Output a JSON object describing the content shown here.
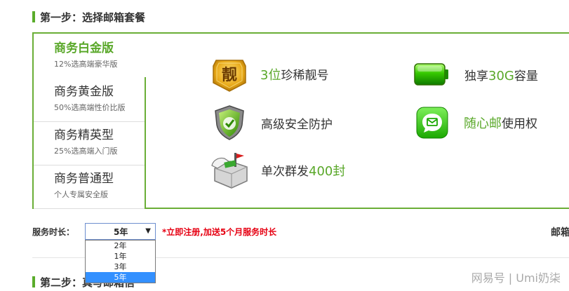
{
  "step1": {
    "title": "第一步：选择邮箱套餐"
  },
  "step2": {
    "title": "第二步：真写邮箱信"
  },
  "packages": [
    {
      "name": "商务白金版",
      "desc": "12%选高端豪华版",
      "active": true
    },
    {
      "name": "商务黄金版",
      "desc": "50%选高端性价比版",
      "active": false
    },
    {
      "name": "商务精英型",
      "desc": "25%选高端入门版",
      "active": false
    },
    {
      "name": "商务普通型",
      "desc": "个人专属安全版",
      "active": false
    }
  ],
  "features": {
    "numbers": {
      "highlight": "3位",
      "text": "珍稀靓号",
      "icon_char": "靓"
    },
    "storage": {
      "prefix": "独享",
      "highlight": "30G",
      "text": "容量"
    },
    "security": {
      "text": "高级安全防护"
    },
    "mobile": {
      "highlight": "随心邮",
      "text": "使用权"
    },
    "mass_send": {
      "prefix": "单次群发",
      "highlight": "400封"
    }
  },
  "service": {
    "label": "服务时长：",
    "selected": "5年",
    "promo": "*立即注册,加送5个月服务时长",
    "options": [
      "2年",
      "1年",
      "3年",
      "5年"
    ]
  },
  "right_cut_text": "邮箱",
  "watermark": "网易号 | Umi奶柒",
  "colors": {
    "accent": "#5aa82a",
    "border": "#6aae36",
    "promo": "#e60012",
    "select_highlight": "#3390ff"
  },
  "icons": [
    "crown-badge-icon",
    "battery-icon",
    "shield-icon",
    "chat-bubble-icon",
    "mailbox-icon"
  ]
}
